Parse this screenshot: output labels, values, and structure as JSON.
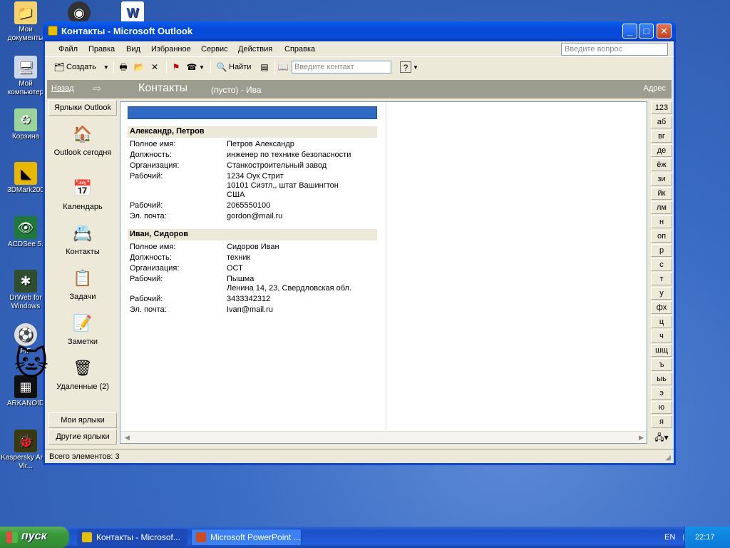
{
  "desktop": {
    "icons": [
      {
        "label": "Мои документы"
      },
      {
        "label": "Мой компьютер"
      },
      {
        "label": "Корзина"
      },
      {
        "label": "3DMark200"
      },
      {
        "label": "ACDSee 5."
      },
      {
        "label": "DrWeb for Windows"
      },
      {
        "label": "FIF"
      },
      {
        "label": "ARKANOID"
      },
      {
        "label": "Kaspersky Anti-Vir..."
      }
    ]
  },
  "window": {
    "title": "Контакты - Microsoft Outlook",
    "min_label": "_",
    "max_label": "□",
    "close_label": "✕"
  },
  "menu": {
    "items": [
      "Файл",
      "Правка",
      "Вид",
      "Избранное",
      "Сервис",
      "Действия",
      "Справка"
    ],
    "ask_placeholder": "Введите вопрос"
  },
  "toolbar": {
    "create_label": "Создать",
    "find_label": "Найти",
    "find_contact_placeholder": "Введите контакт"
  },
  "navbar": {
    "back_label": "Назад",
    "folder_title": "Контакты",
    "subtitle": "(пусто) - Ива",
    "address_label": "Адрес"
  },
  "outlook_bar": {
    "header": "Ярлыки Outlook",
    "items": [
      {
        "label": "Outlook сегодня",
        "icon": "house-icon"
      },
      {
        "label": "Календарь",
        "icon": "calendar-icon"
      },
      {
        "label": "Контакты",
        "icon": "contacts-icon"
      },
      {
        "label": "Задачи",
        "icon": "tasks-icon"
      },
      {
        "label": "Заметки",
        "icon": "notes-icon"
      },
      {
        "label": "Удаленные (2)",
        "icon": "recycle-icon"
      }
    ],
    "my_shortcuts": "Мои ярлыки",
    "other_shortcuts": "Другие ярлыки"
  },
  "contacts": [
    {
      "name": "Александр, Петров",
      "fields": [
        {
          "k": "Полное имя:",
          "v": "Петров Александр"
        },
        {
          "k": "Должность:",
          "v": "инженер по технике безопасности"
        },
        {
          "k": "Организация:",
          "v": "Станкостроительный завод"
        },
        {
          "k": "Рабочий:",
          "v": "1234 Оук Стрит\n10101 Сиэтл,, штат Вашингтон\nСША"
        },
        {
          "k": "Рабочий:",
          "v": "2065550100"
        },
        {
          "k": "Эл. почта:",
          "v": "gordon@mail.ru"
        }
      ]
    },
    {
      "name": "Иван, Сидоров",
      "fields": [
        {
          "k": "Полное имя:",
          "v": "Сидоров Иван"
        },
        {
          "k": "Должность:",
          "v": "техник"
        },
        {
          "k": "Организация:",
          "v": "ОСТ"
        },
        {
          "k": "Рабочий:",
          "v": "Пышма\nЛенина 14, 23, Свердловская обл."
        },
        {
          "k": "Рабочий:",
          "v": "3433342312"
        },
        {
          "k": "Эл. почта:",
          "v": "Ivan@mail.ru"
        }
      ]
    }
  ],
  "index_buttons": [
    "123",
    "аб",
    "вг",
    "де",
    "ёж",
    "зи",
    "йк",
    "лм",
    "н",
    "оп",
    "р",
    "с",
    "т",
    "у",
    "фх",
    "ц",
    "ч",
    "шщ",
    "ъ",
    "ыь",
    "э",
    "ю",
    "я"
  ],
  "status": {
    "text": "Всего элементов: 3"
  },
  "taskbar": {
    "start_label": "пуск",
    "tasks": [
      {
        "label": "Контакты - Microsof..."
      },
      {
        "label": "Microsoft PowerPoint ..."
      }
    ],
    "lang": "EN",
    "time": "22:17"
  }
}
